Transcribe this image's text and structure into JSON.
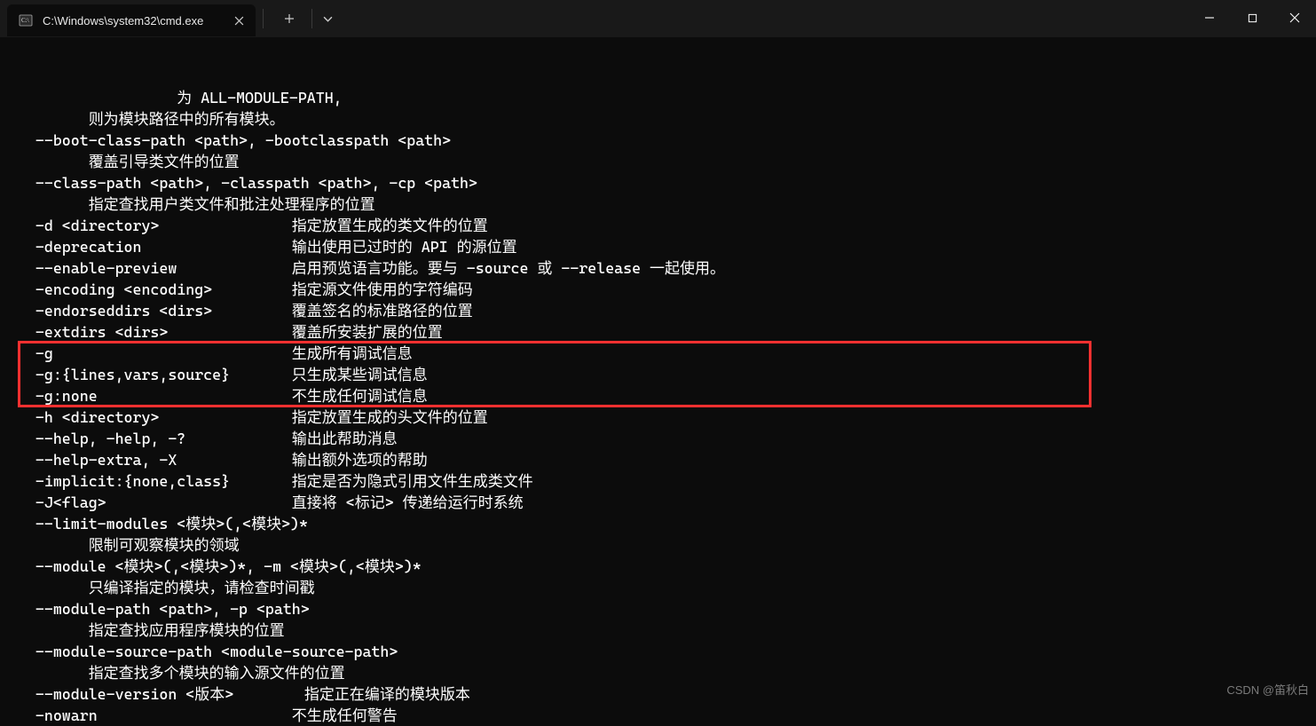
{
  "titlebar": {
    "tab_title": "C:\\Windows\\system32\\cmd.exe"
  },
  "terminal": {
    "lines": [
      "                  为 ALL-MODULE-PATH,",
      "        则为模块路径中的所有模块。",
      "  --boot-class-path <path>, -bootclasspath <path>",
      "        覆盖引导类文件的位置",
      "  --class-path <path>, -classpath <path>, -cp <path>",
      "        指定查找用户类文件和批注处理程序的位置",
      "  -d <directory>               指定放置生成的类文件的位置",
      "  -deprecation                 输出使用已过时的 API 的源位置",
      "  --enable-preview             启用预览语言功能。要与 -source 或 --release 一起使用。",
      "  -encoding <encoding>         指定源文件使用的字符编码",
      "  -endorseddirs <dirs>         覆盖签名的标准路径的位置",
      "  -extdirs <dirs>              覆盖所安装扩展的位置",
      "  -g                           生成所有调试信息",
      "  -g:{lines,vars,source}       只生成某些调试信息",
      "  -g:none                      不生成任何调试信息",
      "  -h <directory>               指定放置生成的头文件的位置",
      "  --help, -help, -?            输出此帮助消息",
      "  --help-extra, -X             输出额外选项的帮助",
      "  -implicit:{none,class}       指定是否为隐式引用文件生成类文件",
      "  -J<flag>                     直接将 <标记> 传递给运行时系统",
      "  --limit-modules <模块>(,<模块>)*",
      "        限制可观察模块的领域",
      "  --module <模块>(,<模块>)*, -m <模块>(,<模块>)*",
      "        只编译指定的模块，请检查时间戳",
      "  --module-path <path>, -p <path>",
      "        指定查找应用程序模块的位置",
      "  --module-source-path <module-source-path>",
      "        指定查找多个模块的输入源文件的位置",
      "  --module-version <版本>        指定正在编译的模块版本",
      "  -nowarn                      不生成任何警告"
    ]
  },
  "highlight": {
    "top_line_index": 12,
    "bottom_line_index": 15
  },
  "watermark": "CSDN @笛秋白"
}
